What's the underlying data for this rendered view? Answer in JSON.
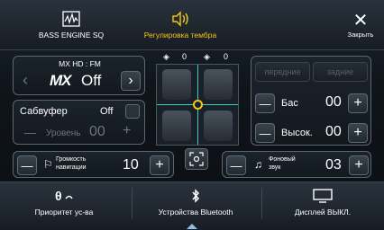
{
  "top_bar": {
    "bass_engine": "BASS ENGINE SQ",
    "timbre": "Регулировка тембра",
    "close": "Закрыть"
  },
  "source_panel": {
    "source": "MX HD : FM",
    "mx_state": "Off",
    "logo_text": "MX"
  },
  "subwoofer": {
    "label": "Сабвуфер",
    "state": "Off",
    "level_label": "Уровень",
    "level_value": "00"
  },
  "balance": {
    "front_value": "0",
    "rear_value": "0"
  },
  "eq": {
    "front_tab": "передние",
    "rear_tab": "задние",
    "bass_label": "Бас",
    "bass_value": "00",
    "treble_label": "Высок.",
    "treble_value": "00"
  },
  "nav_volume": {
    "label_line1": "Громкость",
    "label_line2": "навигации",
    "value": "10"
  },
  "bg_sound": {
    "label_line1": "Фоновый",
    "label_line2": "звук",
    "value": "03"
  },
  "bottom_bar": {
    "priority": "Приоритет ус-ва",
    "bluetooth": "Устройства Bluetooth",
    "display": "Дисплей ВЫКЛ."
  },
  "colors": {
    "accent": "#f5c518",
    "crosshair": "#34d1c6"
  }
}
